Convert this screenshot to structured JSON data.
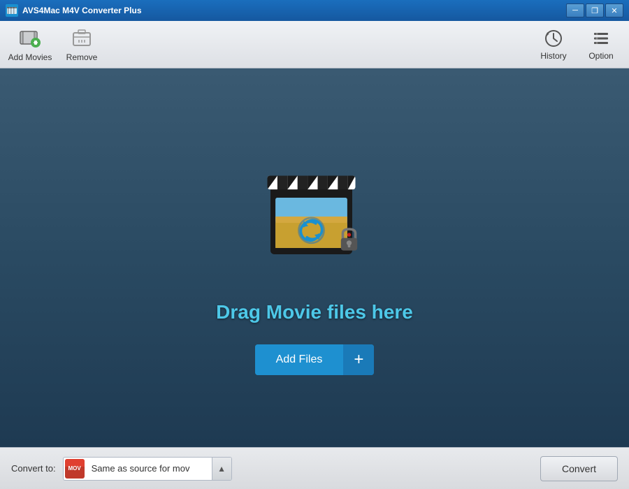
{
  "app": {
    "title": "AVS4Mac M4V Converter Plus",
    "icon_label": "app-icon"
  },
  "window_controls": {
    "minimize_label": "─",
    "restore_label": "❐",
    "close_label": "✕"
  },
  "toolbar": {
    "add_movies_label": "Add Movies",
    "remove_label": "Remove",
    "history_label": "History",
    "option_label": "Option"
  },
  "main": {
    "drag_text": "Drag Movie files here",
    "add_files_label": "Add Files",
    "add_files_plus": "+"
  },
  "bottom": {
    "convert_to_label": "Convert to:",
    "format_text": "Same as source for mov",
    "convert_label": "Convert"
  },
  "colors": {
    "accent_blue": "#1e90d0",
    "drag_text": "#4dc8e8",
    "toolbar_bg": "#f0f2f5",
    "main_bg_top": "#3a5a72",
    "main_bg_bottom": "#1e3a52"
  }
}
